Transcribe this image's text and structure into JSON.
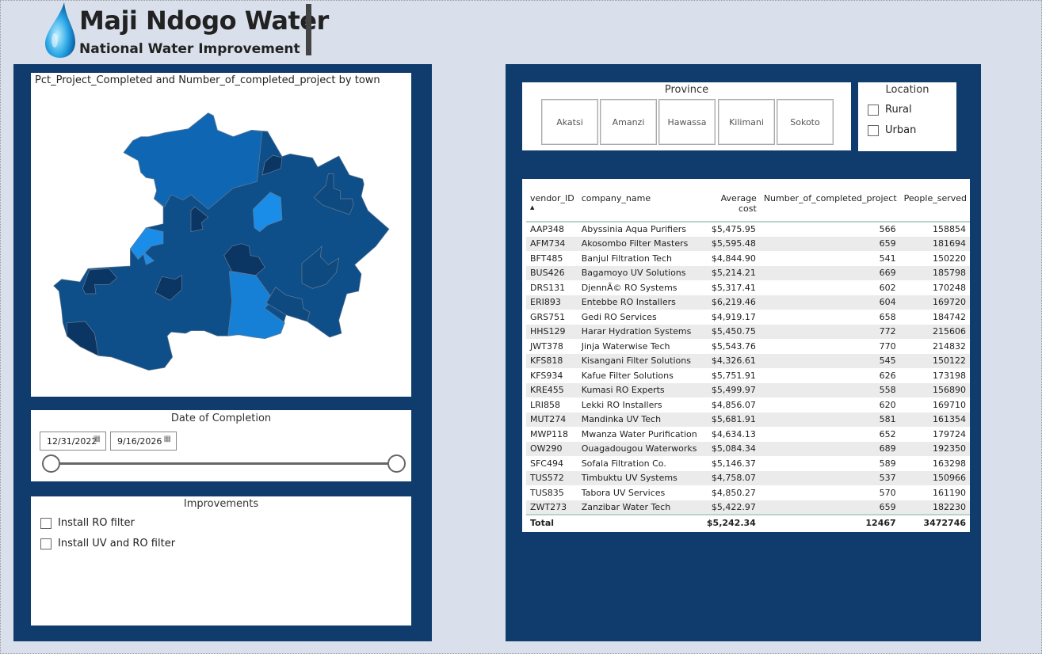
{
  "header": {
    "title": "Maji Ndogo Water",
    "subtitle": "National Water Improvement",
    "logo_icon": "water-drop-icon"
  },
  "map": {
    "title": "Pct_Project_Completed and Number_of_completed_project by town",
    "colors": {
      "base": "#0e4f8a",
      "north": "#0f67b3",
      "light": "#1a8de8",
      "mid_light": "#1580d6",
      "dark": "#0b3563",
      "medium_dark": "#0e4a80"
    }
  },
  "date_slicer": {
    "title": "Date of Completion",
    "start": "12/31/2022",
    "end": "9/16/2026",
    "calendar_icon": "calendar-icon"
  },
  "improvements": {
    "title": "Improvements",
    "options": [
      "Install RO filter",
      "Install UV and RO filter"
    ]
  },
  "province": {
    "title": "Province",
    "options": [
      "Akatsi",
      "Amanzi",
      "Hawassa",
      "Kilimani",
      "Sokoto"
    ]
  },
  "location": {
    "title": "Location",
    "options": [
      "Rural",
      "Urban"
    ]
  },
  "table": {
    "columns": [
      "vendor_ID",
      "company_name",
      "Average cost",
      "Number_of_completed_project",
      "People_served"
    ],
    "rows": [
      [
        "AAP348",
        "Abyssinia Aqua Purifiers",
        "$5,475.95",
        "566",
        "158854"
      ],
      [
        "AFM734",
        "Akosombo Filter Masters",
        "$5,595.48",
        "659",
        "181694"
      ],
      [
        "BFT485",
        "Banjul Filtration Tech",
        "$4,844.90",
        "541",
        "150220"
      ],
      [
        "BUS426",
        "Bagamoyo UV Solutions",
        "$5,214.21",
        "669",
        "185798"
      ],
      [
        "DRS131",
        "DjennÃ© RO Systems",
        "$5,317.41",
        "602",
        "170248"
      ],
      [
        "ERI893",
        "Entebbe RO Installers",
        "$6,219.46",
        "604",
        "169720"
      ],
      [
        "GRS751",
        "Gedi RO Services",
        "$4,919.17",
        "658",
        "184742"
      ],
      [
        "HHS129",
        "Harar Hydration Systems",
        "$5,450.75",
        "772",
        "215606"
      ],
      [
        "JWT378",
        "Jinja Waterwise Tech",
        "$5,543.76",
        "770",
        "214832"
      ],
      [
        "KFS818",
        "Kisangani Filter Solutions",
        "$4,326.61",
        "545",
        "150122"
      ],
      [
        "KFS934",
        "Kafue Filter Solutions",
        "$5,751.91",
        "626",
        "173198"
      ],
      [
        "KRE455",
        "Kumasi RO Experts",
        "$5,499.97",
        "558",
        "156890"
      ],
      [
        "LRI858",
        "Lekki RO Installers",
        "$4,856.07",
        "620",
        "169710"
      ],
      [
        "MUT274",
        "Mandinka UV Tech",
        "$5,681.91",
        "581",
        "161354"
      ],
      [
        "MWP118",
        "Mwanza Water Purification",
        "$4,634.13",
        "652",
        "179724"
      ],
      [
        "OW290",
        "Ouagadougou Waterworks",
        "$5,084.34",
        "689",
        "192350"
      ],
      [
        "SFC494",
        "Sofala Filtration Co.",
        "$5,146.37",
        "589",
        "163298"
      ],
      [
        "TUS572",
        "Timbuktu UV Systems",
        "$4,758.07",
        "537",
        "150966"
      ],
      [
        "TUS835",
        "Tabora UV Services",
        "$4,850.27",
        "570",
        "161190"
      ],
      [
        "ZWT273",
        "Zanzibar Water Tech",
        "$5,422.97",
        "659",
        "182230"
      ]
    ],
    "total": [
      "Total",
      "",
      "$5,242.34",
      "12467",
      "3472746"
    ]
  }
}
